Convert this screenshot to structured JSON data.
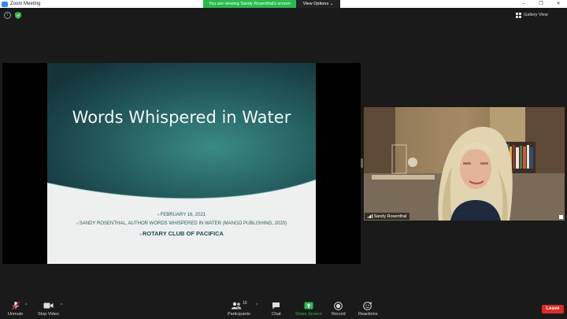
{
  "window": {
    "title": "Zoom Meeting",
    "controls": [
      "–",
      "❐",
      "✕"
    ]
  },
  "share_banner": {
    "viewing_text": "You are viewing Sandy Rosenthal's screen",
    "view_options_label": "View Options ⌄"
  },
  "top_bar": {
    "gallery_view_label": "Gallery View"
  },
  "slide": {
    "title": "Words Whispered in Water",
    "lines": [
      "February 16, 2021",
      "Sandy Rosenthal, Author Words Whispered in Water  (Mango Publishing, 2020)"
    ],
    "emphasis_line": "Rotary Club of Pacifica",
    "bullet_glyph": "»",
    "colors": {
      "teal_dark": "#17393d",
      "teal_mid": "#2d6f6e",
      "text": "#2c5a5b"
    }
  },
  "video": {
    "participant_name": "Sandy Rosenthal"
  },
  "toolbar": {
    "unmute_label": "Unmute",
    "stop_video_label": "Stop Video",
    "participants_label": "Participants",
    "participants_count": "16",
    "chat_label": "Chat",
    "share_screen_label": "Share Screen",
    "record_label": "Record",
    "reactions_label": "Reactions",
    "leave_label": "Leave",
    "caret": "^",
    "colors": {
      "share_green": "#2bba4e",
      "mic_red": "#e02828",
      "leave_red": "#e02828"
    }
  }
}
